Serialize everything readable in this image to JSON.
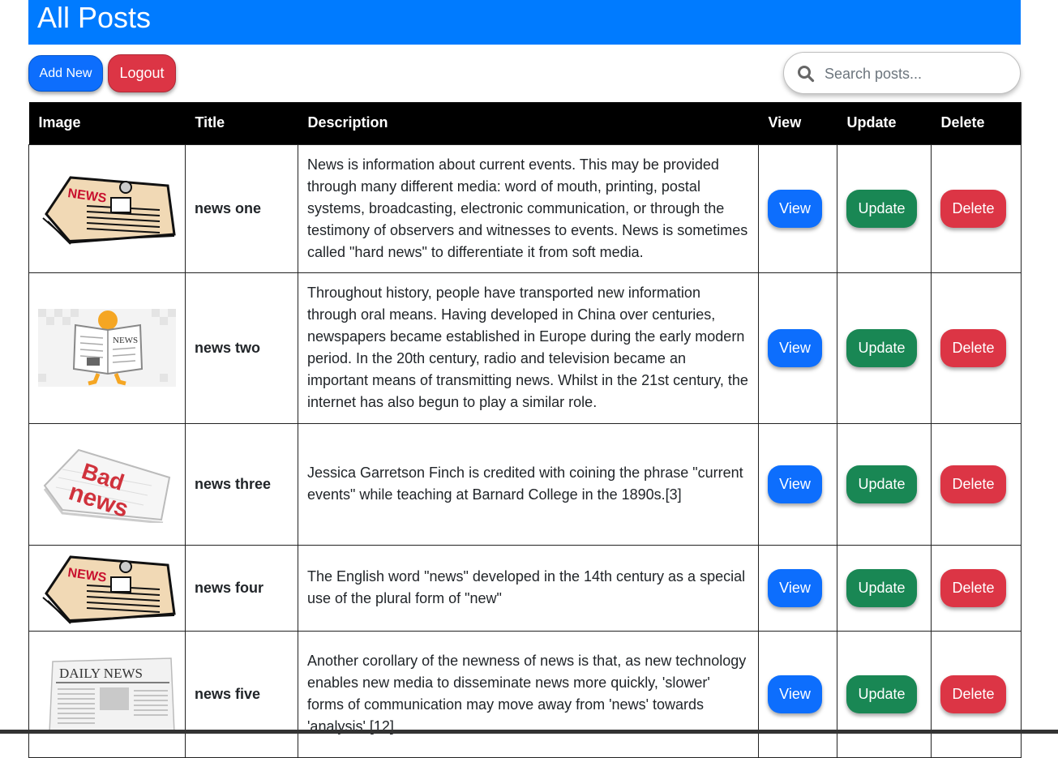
{
  "header": {
    "title": "All Posts"
  },
  "toolbar": {
    "add_label": "Add New",
    "logout_label": "Logout"
  },
  "search": {
    "placeholder": "Search posts...",
    "value": ""
  },
  "table": {
    "columns": [
      "Image",
      "Title",
      "Description",
      "View",
      "Update",
      "Delete"
    ],
    "rows": [
      {
        "image": "news-newspaper-cartoon",
        "title": "news one",
        "description": "News is information about current events. This may be provided through many different media: word of mouth, printing, postal systems, broadcasting, electronic communication, or through the testimony of observers and witnesses to events. News is sometimes called \"hard news\" to differentiate it from soft media.",
        "view": "View",
        "update": "Update",
        "delete": "Delete"
      },
      {
        "image": "newspaper-reader-character",
        "title": "news two",
        "description": "Throughout history, people have transported new information through oral means. Having developed in China over centuries, newspapers became established in Europe during the early modern period. In the 20th century, radio and television became an important means of transmitting news. Whilst in the 21st century, the internet has also begun to play a similar role.",
        "view": "View",
        "update": "Update",
        "delete": "Delete"
      },
      {
        "image": "bad-news-newspaper",
        "title": "news three",
        "description": "Jessica Garretson Finch is credited with coining the phrase \"current events\" while teaching at Barnard College in the 1890s.[3]",
        "view": "View",
        "update": "Update",
        "delete": "Delete"
      },
      {
        "image": "news-newspaper-cartoon",
        "title": "news four",
        "description": "The English word \"news\" developed in the 14th century as a special use of the plural form of \"new\"",
        "view": "View",
        "update": "Update",
        "delete": "Delete"
      },
      {
        "image": "daily-news-newspaper",
        "title": "news five",
        "description": "Another corollary of the newness of news is that, as new technology enables new media to disseminate news more quickly, 'slower' forms of communication may move away from 'news' towards 'analysis'.[12]",
        "view": "View",
        "update": "Update",
        "delete": "Delete"
      }
    ],
    "image_labels": {
      "news": "NEWS",
      "bad_1": "Bad",
      "bad_2": "news",
      "daily": "DAILY NEWS"
    }
  },
  "colors": {
    "primary": "#0d6efd",
    "header": "#007bff",
    "success": "#198754",
    "danger": "#dc3545",
    "table_head": "#000000"
  }
}
